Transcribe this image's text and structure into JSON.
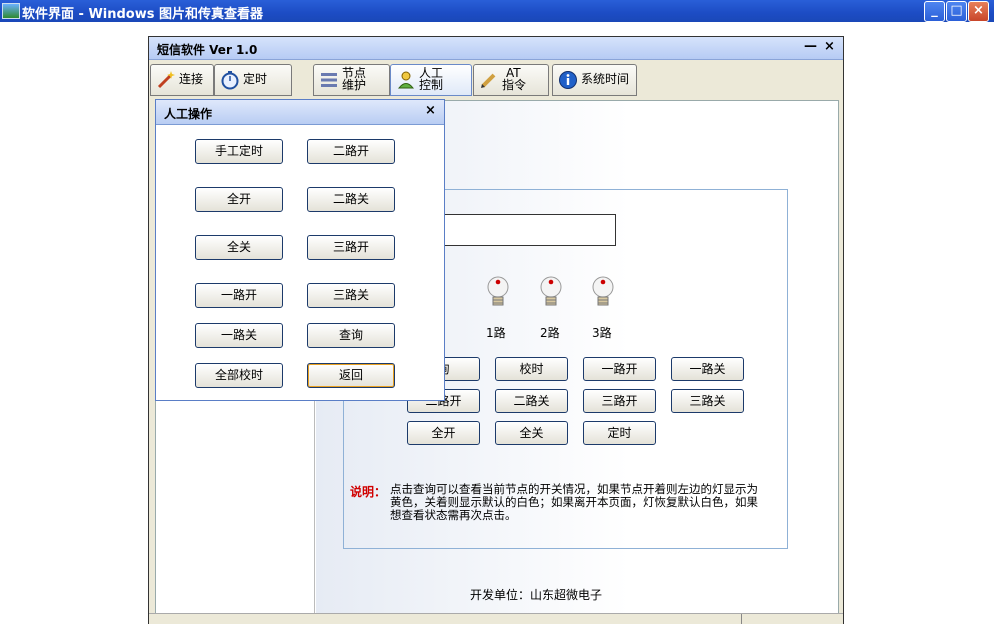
{
  "window": {
    "title": "软件界面 - Windows 图片和传真查看器",
    "minimize": "_",
    "maximize": "□",
    "close": "×"
  },
  "app": {
    "title": "短信软件 Ver 1.0",
    "minimize": "—",
    "close": "×"
  },
  "tabs": [
    {
      "label": "连接",
      "icon": "wand-icon"
    },
    {
      "label": "定时",
      "icon": "stopwatch-icon"
    },
    {
      "label_line1": "节点",
      "label_line2": "维护",
      "icon": "list-icon"
    },
    {
      "label_line1": "人工",
      "label_line2": "控制",
      "icon": "user-icon"
    },
    {
      "label_line1": "AT",
      "label_line2": "指令",
      "icon": "pencil-icon"
    },
    {
      "label": "系统时间",
      "icon": "info-icon"
    }
  ],
  "lamps": [
    "1路",
    "2路",
    "3路"
  ],
  "control_buttons": [
    [
      "询",
      "校时",
      "一路开",
      "一路关"
    ],
    [
      "二路开",
      "二路关",
      "三路开",
      "三路关"
    ],
    [
      "全开",
      "全关",
      "定时"
    ]
  ],
  "note": {
    "label": "说明：",
    "text": "点击查询可以查看当前节点的开关情况，如果节点开着则左边的灯显示为黄色，关着则显示默认的白色；如果离开本页面，灯恢复默认白色，如果想查看状态需再次点击。"
  },
  "footer": "开发单位：山东超微电子",
  "dialog": {
    "title": "人工操作",
    "close": "×",
    "buttons": [
      [
        "手工定时",
        "二路开"
      ],
      [
        "全开",
        "二路关"
      ],
      [
        "全关",
        "三路开"
      ],
      [
        "一路开",
        "三路关"
      ],
      [
        "一路关",
        "查询"
      ],
      [
        "全部校时",
        "返回"
      ]
    ]
  }
}
